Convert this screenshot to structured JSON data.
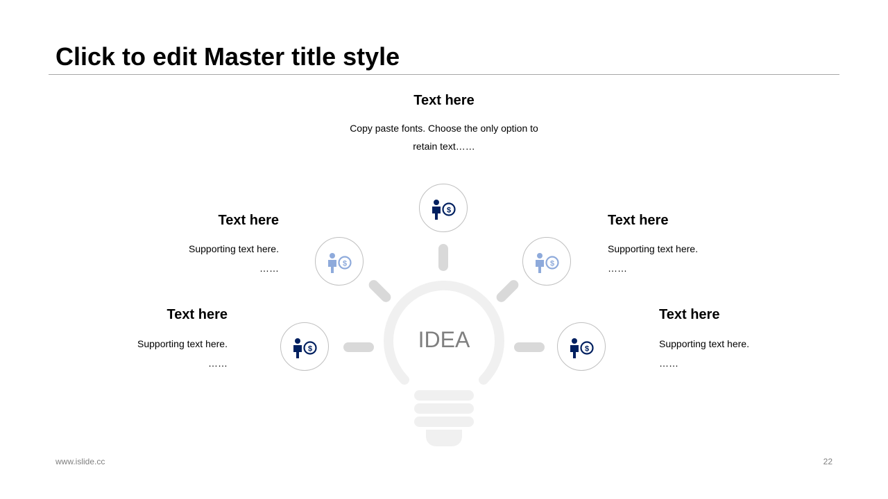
{
  "slide": {
    "title": "Click to edit Master title style",
    "footer_left": "www.islide.cc",
    "page_number": "22"
  },
  "diagram": {
    "center_label": "IDEA",
    "icon": "person-dollar-icon",
    "colors": {
      "icon_dark": "#002060",
      "icon_light": "#8eaadb",
      "bulb": "#f0f0f0",
      "ray": "#d9d9d9",
      "circle_border": "#bfbfbf"
    },
    "items": [
      {
        "heading": "Text here",
        "line1": "Copy paste fonts. Choose the only option to",
        "line2": "retain text……"
      },
      {
        "heading": "Text here",
        "line1": "Supporting text here.",
        "line2": "……"
      },
      {
        "heading": "Text here",
        "line1": "Supporting text here.",
        "line2": "……"
      },
      {
        "heading": "Text here",
        "line1": "Supporting text here.",
        "line2": "……"
      },
      {
        "heading": "Text here",
        "line1": "Supporting text here.",
        "line2": "……"
      }
    ]
  }
}
